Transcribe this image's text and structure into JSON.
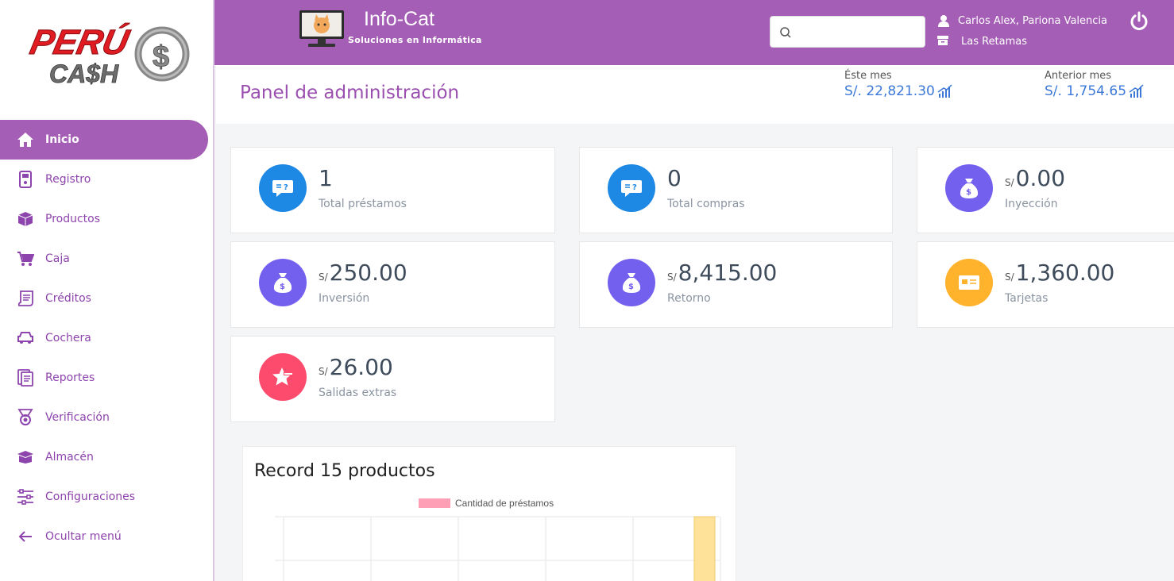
{
  "sidebar": {
    "logo_text_top": "PERÚ",
    "logo_text_bottom": "CA$H",
    "items": [
      {
        "label": "Inicio",
        "icon": "home-icon",
        "active": true
      },
      {
        "label": "Registro",
        "icon": "phone-icon"
      },
      {
        "label": "Productos",
        "icon": "cube-icon"
      },
      {
        "label": "Caja",
        "icon": "cart-icon"
      },
      {
        "label": "Créditos",
        "icon": "receipt-icon"
      },
      {
        "label": "Cochera",
        "icon": "car-icon"
      },
      {
        "label": "Reportes",
        "icon": "document-icon"
      },
      {
        "label": "Verificación",
        "icon": "medal-icon"
      },
      {
        "label": "Almacén",
        "icon": "box-icon"
      },
      {
        "label": "Configuraciones",
        "icon": "sliders-icon"
      },
      {
        "label": "Ocultar menú",
        "icon": "arrow-left-icon"
      }
    ]
  },
  "header": {
    "brand_title": "Info-Cat",
    "brand_subtitle": "Soluciones en Informática",
    "search_placeholder": "",
    "user_name": "Carlos Alex, Pariona Valencia",
    "store_name": "Las Retamas"
  },
  "titlebar": {
    "title": "Panel de administración",
    "this_month_label": "Éste mes",
    "this_month_value": "S/. 22,821.30",
    "last_month_label": "Anterior mes",
    "last_month_value": "S/. 1,754.65"
  },
  "cards": [
    {
      "value": "1",
      "currency": "",
      "label": "Total préstamos",
      "icon": "chat-question-icon",
      "color": "#1e88e5"
    },
    {
      "value": "0",
      "currency": "",
      "label": "Total compras",
      "icon": "chat-question-icon",
      "color": "#1e88e5"
    },
    {
      "value": "0.00",
      "currency": "S/",
      "label": "Inyección",
      "icon": "money-bag-icon",
      "color": "#7460ee"
    },
    {
      "value": "250.00",
      "currency": "S/",
      "label": "Inversión",
      "icon": "money-bag-icon",
      "color": "#7460ee"
    },
    {
      "value": "8,415.00",
      "currency": "S/",
      "label": "Retorno",
      "icon": "money-bag-icon",
      "color": "#7460ee"
    },
    {
      "value": "1,360.00",
      "currency": "S/",
      "label": "Tarjetas",
      "icon": "card-icon",
      "color": "#ffb22b"
    },
    {
      "value": "26.00",
      "currency": "S/",
      "label": "Salidas extras",
      "icon": "star-minus-icon",
      "color": "#fc4b6c"
    }
  ],
  "chart": {
    "title": "Record 15 productos",
    "legend": "Cantidad de préstamos",
    "legend_color": "#ff9fb5",
    "bar_color": "#ffe29a"
  },
  "colors": {
    "brand": "#a55eb5",
    "accent_blue": "#3c78d8"
  }
}
